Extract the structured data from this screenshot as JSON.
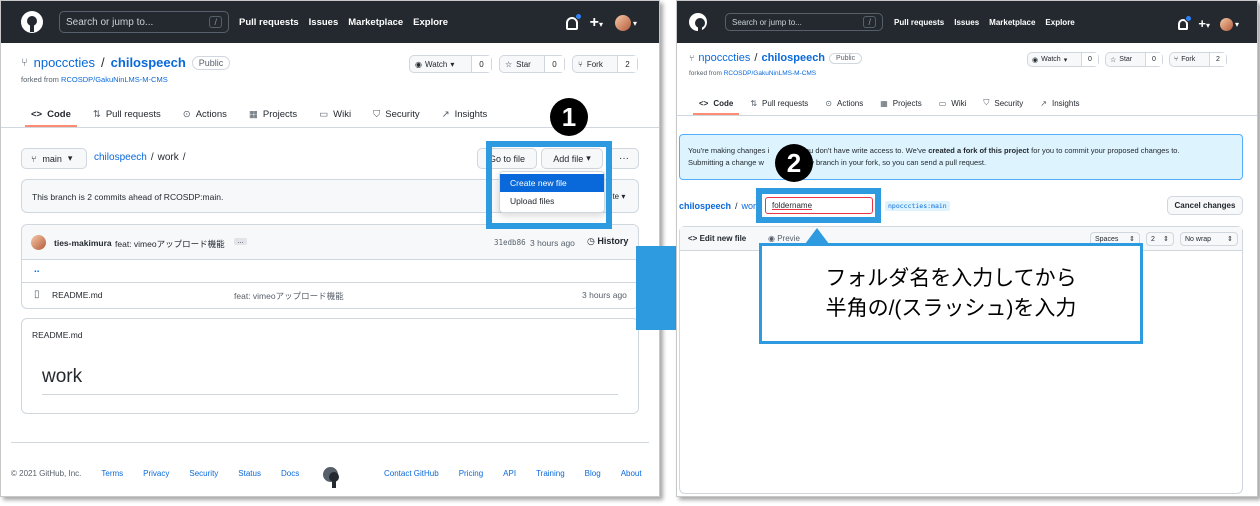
{
  "left": {
    "header": {
      "search_placeholder": "Search or jump to...",
      "slash": "/",
      "nav": [
        "Pull requests",
        "Issues",
        "Marketplace",
        "Explore"
      ]
    },
    "repo": {
      "owner": "npocccties",
      "sep": "/",
      "name": "chilospeech",
      "visibility": "Public",
      "forked_prefix": "forked from",
      "forked_source": "RCOSDP/GakuNinLMS-M-CMS"
    },
    "actions": {
      "watch_label": "Watch",
      "watch_count": "0",
      "star_label": "Star",
      "star_count": "0",
      "fork_label": "Fork",
      "fork_count": "2"
    },
    "tabs": [
      "Code",
      "Pull requests",
      "Actions",
      "Projects",
      "Wiki",
      "Security",
      "Insights"
    ],
    "branch": "main",
    "path": {
      "repo": "chilospeech",
      "sep1": "/",
      "folder": "work",
      "sep2": "/"
    },
    "goto_file": "Go to file",
    "add_file": "Add file",
    "more": "···",
    "menu": {
      "create": "Create new file",
      "upload": "Upload files"
    },
    "ahead_text": "This branch is 2 commits ahead of RCOSDP:main.",
    "contribute_partial": "ute",
    "commit": {
      "author": "ties-makimura",
      "message": "feat: vimeoアップロード機能",
      "ellipsis": "…",
      "hash": "31edb86",
      "time": "3 hours ago",
      "history": "History"
    },
    "files": [
      {
        "name": "..",
        "message": "",
        "time": ""
      },
      {
        "name": "README.md",
        "message": "feat: vimeoアップロード機能",
        "time": "3 hours ago"
      }
    ],
    "readme": {
      "filename": "README.md",
      "heading": "work"
    },
    "footer": {
      "copyright": "© 2021 GitHub, Inc.",
      "links_left": [
        "Terms",
        "Privacy",
        "Security",
        "Status",
        "Docs"
      ],
      "links_right": [
        "Contact GitHub",
        "Pricing",
        "API",
        "Training",
        "Blog",
        "About"
      ]
    },
    "callout_number": "1"
  },
  "right": {
    "header": {
      "search_placeholder": "Search or jump to...",
      "slash": "/",
      "nav": [
        "Pull requests",
        "Issues",
        "Marketplace",
        "Explore"
      ]
    },
    "repo": {
      "owner": "npocccties",
      "sep": "/",
      "name": "chilospeech",
      "visibility": "Public",
      "forked_prefix": "forked from",
      "forked_source": "RCOSDP/GakuNinLMS-M-CMS"
    },
    "actions": {
      "watch_label": "Watch",
      "watch_count": "0",
      "star_label": "Star",
      "star_count": "0",
      "fork_label": "Fork",
      "fork_count": "2"
    },
    "tabs": [
      "Code",
      "Pull requests",
      "Actions",
      "Projects",
      "Wiki",
      "Security",
      "Insights"
    ],
    "flash": {
      "line1_a": "You're making changes i",
      "line1_b": "you don't have write access to. We've ",
      "line1_bold": "created a fork of this project",
      "line1_c": " for you to commit your proposed changes to.",
      "line2_a": "Submitting a change w",
      "line2_b": "e new branch in your fork, so you can send a pull request."
    },
    "path": {
      "repo": "chilospeech",
      "sep": "/",
      "folder": "work"
    },
    "filename_value": "foldername",
    "branch_tag": "npocccties:main",
    "cancel": "Cancel changes",
    "edit_tab": "Edit new file",
    "preview_tab": "Previe",
    "indent_mode": "Spaces",
    "indent_size": "2",
    "wrap_mode": "No wrap",
    "note_line1": "フォルダ名を入力してから",
    "note_line2": "半角の/(スラッシュ)を入力",
    "callout_number": "2"
  },
  "colors": {
    "accent": "#2e9ae0",
    "header": "#24292f",
    "link": "#0969da",
    "tab_underline": "#fd8c73"
  }
}
